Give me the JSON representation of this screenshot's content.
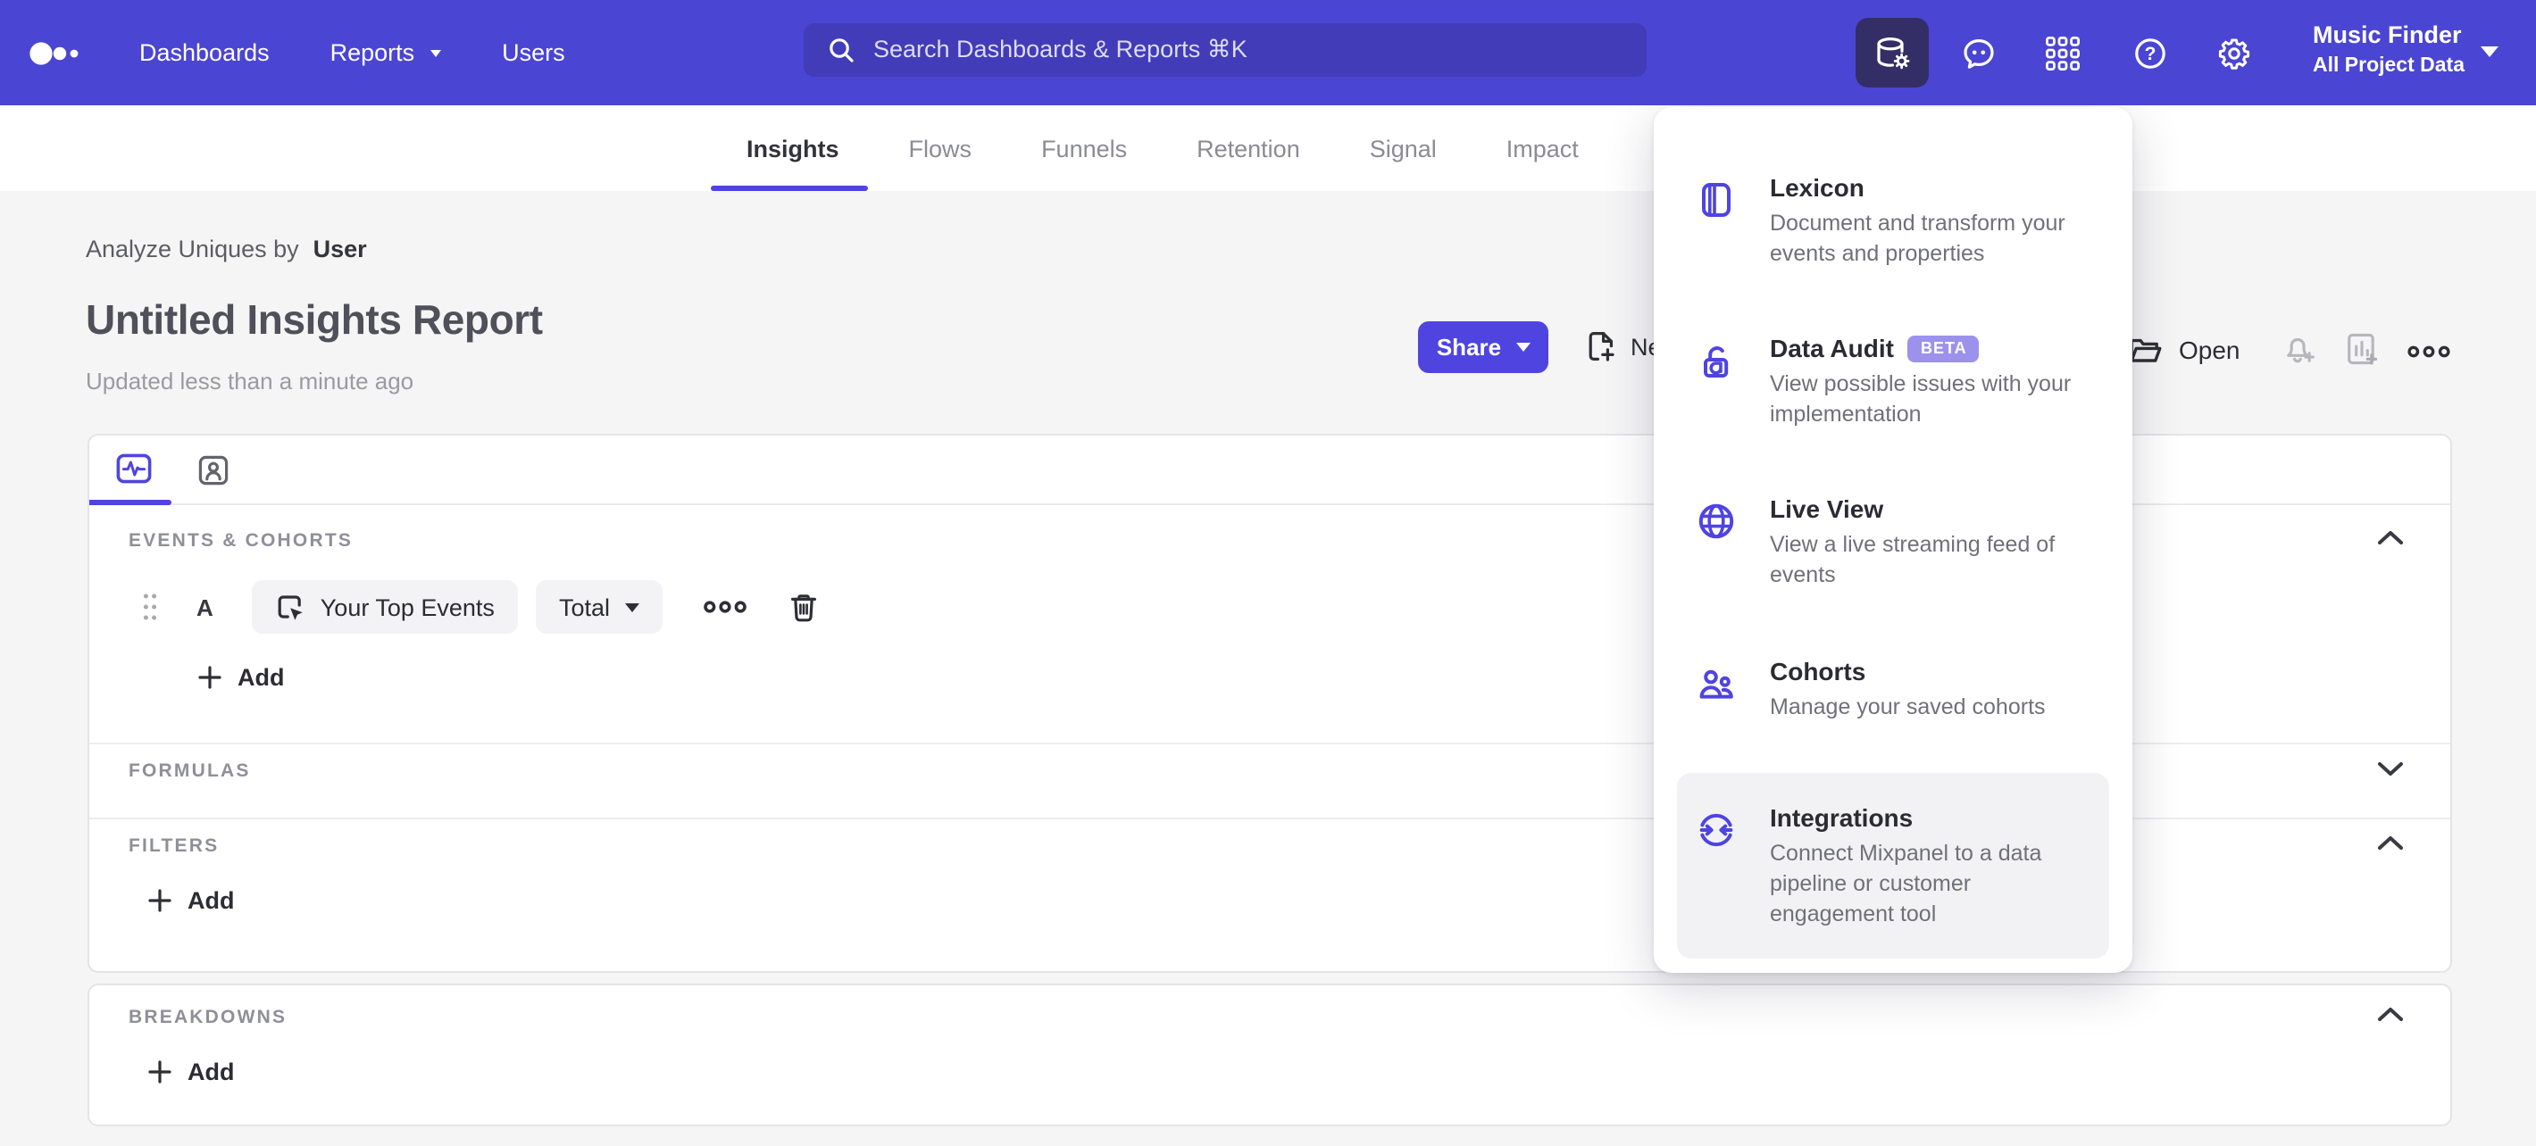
{
  "header": {
    "nav": [
      {
        "label": "Dashboards"
      },
      {
        "label": "Reports",
        "has_caret": true
      },
      {
        "label": "Users"
      }
    ],
    "search_placeholder": "Search Dashboards & Reports ⌘K",
    "project_name": "Music Finder",
    "project_scope": "All Project Data",
    "tool_icons": [
      "data-management-icon",
      "feedback-icon",
      "apps-grid-icon",
      "help-icon",
      "settings-icon"
    ]
  },
  "tabs": {
    "items": [
      {
        "label": "Insights",
        "active": true
      },
      {
        "label": "Flows"
      },
      {
        "label": "Funnels"
      },
      {
        "label": "Retention"
      },
      {
        "label": "Signal"
      },
      {
        "label": "Impact"
      }
    ]
  },
  "report": {
    "breadcrumb_prefix": "Analyze Uniques by",
    "breadcrumb_value": "User",
    "title": "Untitled Insights Report",
    "updated": "Updated less than a minute ago",
    "share_label": "Share",
    "new_label": "New",
    "open_label": "Open"
  },
  "builder": {
    "sections": {
      "events": "EVENTS & COHORTS",
      "formulas": "FORMULAS",
      "filters": "FILTERS",
      "breakdowns": "BREAKDOWNS"
    },
    "event_row": {
      "letter": "A",
      "event": "Your Top Events",
      "metric": "Total"
    },
    "add_label": "Add"
  },
  "menu": {
    "items": [
      {
        "name": "Lexicon",
        "desc": "Document and transform your events and properties",
        "icon": "book-icon"
      },
      {
        "name": "Data Audit",
        "badge": "BETA",
        "desc": "View possible issues with your implementation",
        "icon": "lock-icon"
      },
      {
        "name": "Live View",
        "desc": "View a live streaming feed of events",
        "icon": "globe-icon"
      },
      {
        "name": "Cohorts",
        "desc": "Manage your saved cohorts",
        "icon": "people-icon"
      },
      {
        "name": "Integrations",
        "desc": "Connect Mixpanel to a data pipeline or customer engagement tool",
        "icon": "sync-arrows-icon",
        "highlighted": true
      }
    ]
  },
  "colors": {
    "accent": "#4f44e0",
    "header_bg": "#4b45d3",
    "search_bg": "#423cb9",
    "active_tool_bg": "#332e66",
    "beta_badge_bg": "#9c92ec",
    "page_bg": "#f5f5f6"
  }
}
